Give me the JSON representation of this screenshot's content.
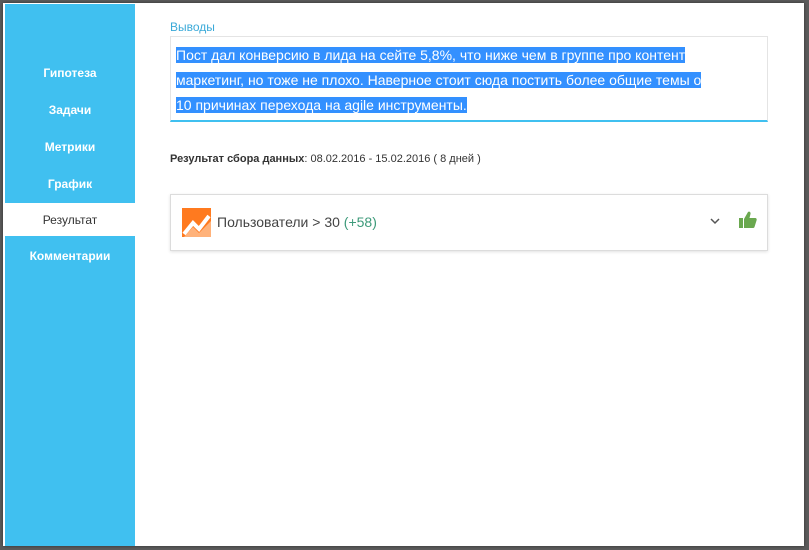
{
  "sidebar": {
    "items": [
      {
        "label": "Гипотеза"
      },
      {
        "label": "Задачи"
      },
      {
        "label": "Метрики"
      },
      {
        "label": "График"
      },
      {
        "label": "Результат"
      },
      {
        "label": "Комментарии"
      }
    ],
    "active_index": 4
  },
  "conclusions": {
    "label": "Выводы",
    "lines": [
      "Пост дал конверсию в лида на сейте 5,8%, что ниже чем в группе про контент",
      "маркетинг, но тоже не плохо. Наверное стоит сюда постить более общие темы о",
      "10 причинах перехода на agile инструменты."
    ]
  },
  "result": {
    "label": "Результат сбора данных",
    "value": ": 08.02.2016 - 15.02.2016 ( 8 дней )"
  },
  "metric": {
    "name": "Пользователи > 30",
    "delta": "(+58)",
    "icon": "trend-chart-icon",
    "expand_icon": "chevron-down-icon",
    "status_icon": "thumbs-up-icon"
  },
  "colors": {
    "sidebar": "#40c0f0",
    "selection": "#3390ff",
    "accent_label": "#3aa9d8",
    "metric_icon": "#ff7a1f",
    "delta": "#3d9a7a",
    "thumbs_up": "#6aa84f"
  }
}
